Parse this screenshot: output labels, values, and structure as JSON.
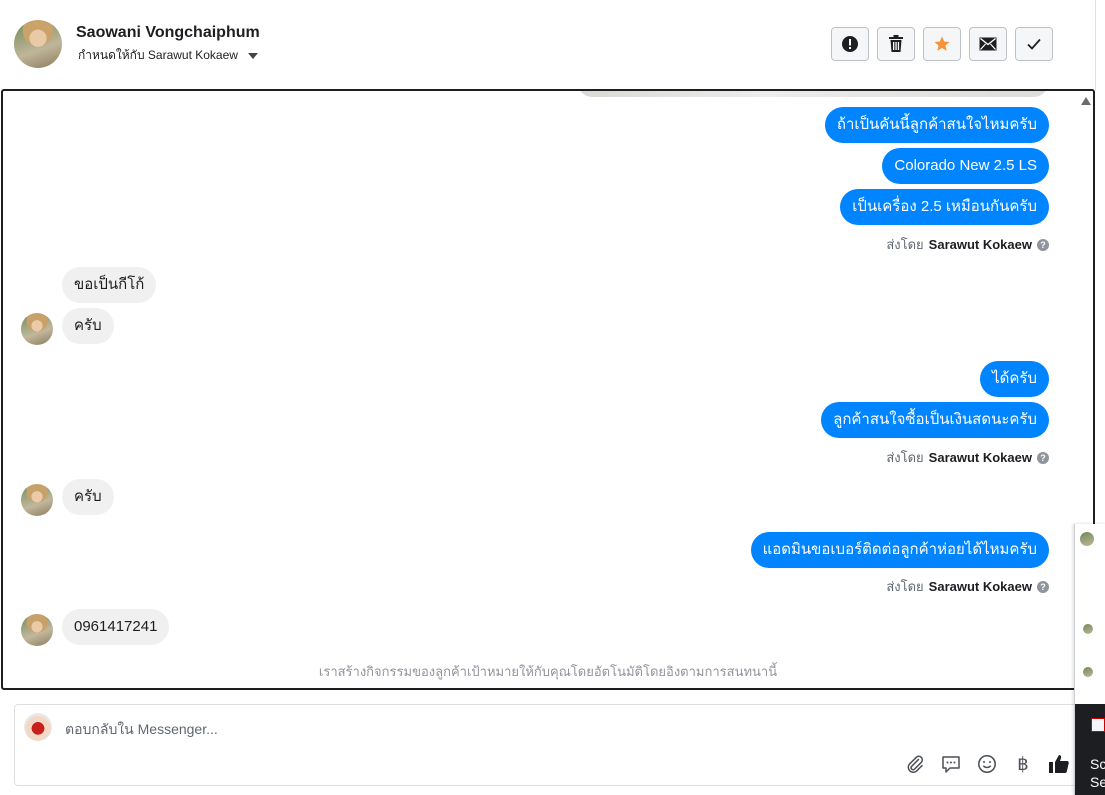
{
  "header": {
    "name": "Saowani Vongchaiphum",
    "assigned": "กำหนดให้กับ Sarawut Kokaew"
  },
  "actions": [
    {
      "name": "spam-icon"
    },
    {
      "name": "trash-icon"
    },
    {
      "name": "star-icon",
      "color": "#f7923a"
    },
    {
      "name": "envelope-icon"
    },
    {
      "name": "checkmark-icon"
    }
  ],
  "messages": {
    "out1": "ถ้าเป็นคันนี้ลูกค้าสนใจไหมครับ",
    "out2": "Colorado New 2.5 LS",
    "out3": "เป็นเครื่อง 2.5 เหมือนกันครับ",
    "in1": "ขอเป็นกีโก้",
    "in2": "ครับ",
    "out4": "ได้ครับ",
    "out5": "ลูกค้าสนใจซื้อเป็นเงินสดนะครับ",
    "in3": "ครับ",
    "out6": "แอดมินขอเบอร์ติดต่อลูกค้าห่อยได้ไหมครับ",
    "in4": "0961417241"
  },
  "sent_by_prefix": "ส่งโดย",
  "sent_by_name": "Sarawut Kokaew",
  "help_mark": "?",
  "auto_note": "เราสร้างกิจกรรมของลูกค้าเป้าหมายให้กับคุณโดยอัตโนมัติโดยอิงตามการสนทนานี้",
  "composer": {
    "placeholder": "ตอบกลับใน Messenger...",
    "baht": "฿"
  },
  "side_panel": {
    "line1": "Sc",
    "line2": "Se"
  },
  "colors": {
    "outgoing_bubble": "#0084ff",
    "incoming_bubble": "#f0f0f0"
  }
}
